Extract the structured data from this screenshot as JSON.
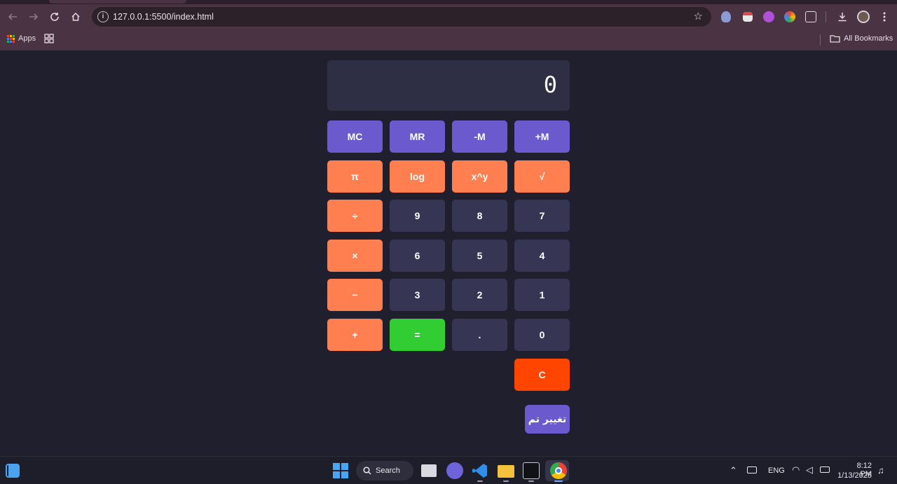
{
  "browser": {
    "url": "127.0.0.1:5500/index.html",
    "bookmarks": {
      "apps_label": "Apps",
      "all_bookmarks_label": "All Bookmarks"
    }
  },
  "calculator": {
    "display_value": "0",
    "memory_row": [
      "MC",
      "MR",
      "-M",
      "+M"
    ],
    "function_row": [
      "π",
      "log",
      "x^y",
      "√"
    ],
    "row_div": [
      "÷",
      "9",
      "8",
      "7"
    ],
    "row_mul": [
      "×",
      "6",
      "5",
      "4"
    ],
    "row_sub": [
      "−",
      "3",
      "2",
      "1"
    ],
    "row_add": [
      "+",
      "=",
      ".",
      "0"
    ],
    "clear_label": "C",
    "language_button_label": "تغییر تم"
  },
  "taskbar": {
    "search_label": "Search",
    "language": "ENG",
    "time": "8:12 PM",
    "date": "1/13/2025"
  },
  "colors": {
    "memory_key": "#6a5acd",
    "operator_key": "#ff7f50",
    "number_key": "#363654",
    "equals_key": "#32cd32",
    "clear_key": "#ff4500",
    "page_background": "#1f1f2e"
  }
}
